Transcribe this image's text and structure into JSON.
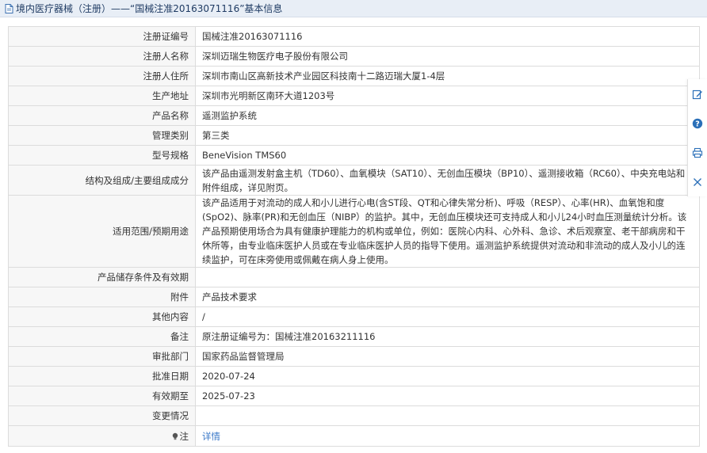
{
  "header": {
    "title": "境内医疗器械（注册）——“国械注准20163071116”基本信息"
  },
  "colors": {
    "header_bg": "#e8eef6",
    "header_text": "#1f3b63",
    "label_bg": "#f7f7f7",
    "link": "#3a78c8",
    "toolbar_icon": "#2a6fb8"
  },
  "icons": {
    "header": "document-icon",
    "note": "lightbulb-icon",
    "toolbar": [
      "edit-icon",
      "help-icon",
      "print-icon",
      "close-icon"
    ]
  },
  "rows": [
    {
      "label": "注册证编号",
      "value": "国械注准20163071116"
    },
    {
      "label": "注册人名称",
      "value": "深圳迈瑞生物医疗电子股份有限公司"
    },
    {
      "label": "注册人住所",
      "value": "深圳市南山区高新技术产业园区科技南十二路迈瑞大厦1-4层"
    },
    {
      "label": "生产地址",
      "value": "深圳市光明新区南环大道1203号"
    },
    {
      "label": "产品名称",
      "value": "遥测监护系统"
    },
    {
      "label": "管理类别",
      "value": "第三类"
    },
    {
      "label": "型号规格",
      "value": "BeneVision TMS60"
    },
    {
      "label": "结构及组成/主要组成成分",
      "value": "该产品由遥测发射盒主机（TD60）、血氧模块（SAT10）、无创血压模块（BP10）、遥测接收箱（RC60）、中央充电站和附件组成，详见附页。"
    },
    {
      "label": "适用范围/预期用途",
      "value": "该产品适用于对流动的成人和小儿进行心电(含ST段、QT和心律失常分析)、呼吸（RESP）、心率(HR)、血氧饱和度(SpO2)、脉率(PR)和无创血压（NIBP）的监护。其中，无创血压模块还可支持成人和小儿24小时血压测量统计分析。该产品预期使用场合为具有健康护理能力的机构或单位，例如：医院心内科、心外科、急诊、术后观察室、老干部病房和干休所等，由专业临床医护人员或在专业临床医护人员的指导下使用。遥测监护系统提供对流动和非流动的成人及小儿的连续监护，可在床旁使用或佩戴在病人身上使用。"
    },
    {
      "label": "产品储存条件及有效期",
      "value": ""
    },
    {
      "label": "附件",
      "value": "产品技术要求"
    },
    {
      "label": "其他内容",
      "value": "/"
    },
    {
      "label": "备注",
      "value": "原注册证编号为：国械注准20163211116"
    },
    {
      "label": "审批部门",
      "value": "国家药品监督管理局"
    },
    {
      "label": "批准日期",
      "value": "2020-07-24"
    },
    {
      "label": "有效期至",
      "value": "2025-07-23"
    },
    {
      "label": "变更情况",
      "value": ""
    },
    {
      "label": "注",
      "value": "详情"
    }
  ]
}
